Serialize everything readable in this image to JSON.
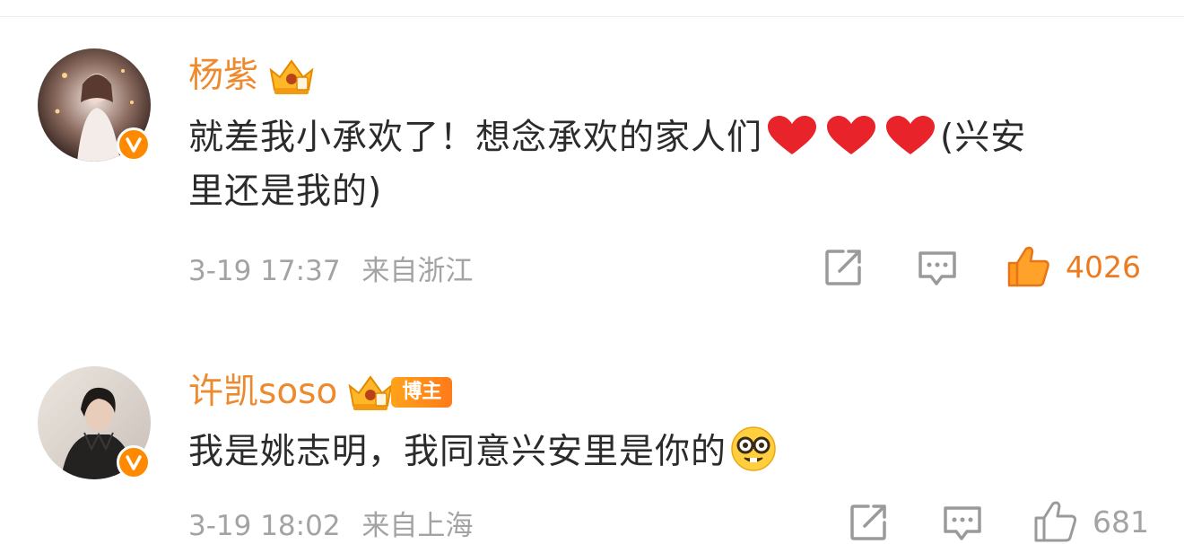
{
  "comments": [
    {
      "author": "杨紫",
      "text_line1": "就差我小承欢了！想念承欢的家人们",
      "text_after_hearts": "(兴安",
      "text_line2": "里还是我的)",
      "date": "3-19 17:37",
      "location": "来自浙江",
      "likes": "4026",
      "avatar_icon": "avatar-photo",
      "verified_icon": "verified-v-icon",
      "crown_icon": "crown-badge-icon"
    },
    {
      "author": "许凯soso",
      "badge": "博主",
      "text": "我是姚志明，我同意兴安里是你的",
      "emoji": "nerd-face-emoji",
      "date": "3-19 18:02",
      "location": "来自上海",
      "likes": "681",
      "avatar_icon": "avatar-photo",
      "verified_icon": "verified-v-icon",
      "crown_icon": "crown-badge-icon"
    }
  ],
  "colors": {
    "name": "#ee8a2e",
    "text": "#2b2b2b",
    "meta": "#a3a3a3",
    "accent": "#ff8a00",
    "like_count": "#ee7a1e",
    "heart": "#e8232a"
  }
}
